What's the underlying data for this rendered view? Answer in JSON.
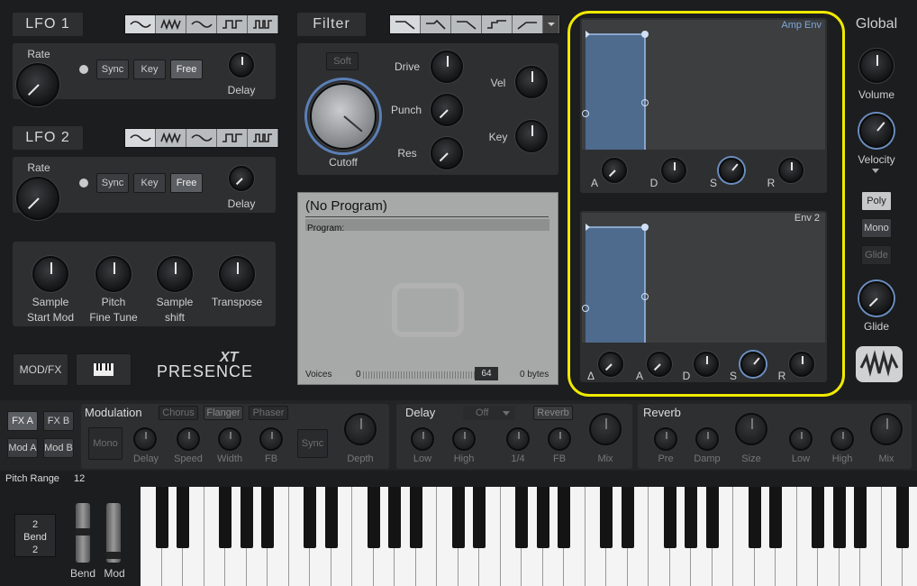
{
  "lfo1": {
    "title": "LFO 1",
    "rate": "Rate",
    "delay": "Delay",
    "sync": "Sync",
    "key": "Key",
    "free": "Free"
  },
  "lfo2": {
    "title": "LFO 2",
    "rate": "Rate",
    "delay": "Delay",
    "sync": "Sync",
    "key": "Key",
    "free": "Free"
  },
  "sample": {
    "start_mod": "Sample\nStart Mod",
    "start": "Sample",
    "start2": "Start Mod",
    "pitch": "Pitch",
    "fine": "Fine Tune",
    "shift1": "Sample",
    "shift2": "shift",
    "transpose": "Transpose"
  },
  "filter": {
    "title": "Filter",
    "soft": "Soft",
    "cutoff": "Cutoff",
    "drive": "Drive",
    "punch": "Punch",
    "res": "Res",
    "vel": "Vel",
    "key": "Key"
  },
  "program": {
    "name": "(No Program)",
    "label": "Program:",
    "voices": "Voices",
    "voices_min": "0",
    "voices_val": "64",
    "bytes": "0 bytes"
  },
  "amp_env": {
    "title": "Amp Env",
    "a": "A",
    "d": "D",
    "s": "S",
    "r": "R"
  },
  "env2": {
    "title": "Env 2",
    "delta": "Δ",
    "a": "A",
    "d": "D",
    "s": "S",
    "r": "R"
  },
  "global": {
    "title": "Global",
    "volume": "Volume",
    "velocity": "Velocity",
    "poly": "Poly",
    "mono": "Mono",
    "glide_btn": "Glide",
    "glide": "Glide"
  },
  "buttons": {
    "modfx": "MOD/FX",
    "brand": "PRESENCE",
    "brand_sup": "XT"
  },
  "fx": {
    "fxa": "FX A",
    "fxb": "FX B",
    "moda": "Mod A",
    "modb": "Mod B",
    "modulation": {
      "title": "Modulation",
      "chorus": "Chorus",
      "flanger": "Flanger",
      "phaser": "Phaser",
      "mono": "Mono",
      "delay": "Delay",
      "speed": "Speed",
      "width": "Width",
      "fb": "FB",
      "sync": "Sync",
      "depth": "Depth"
    },
    "delay": {
      "title": "Delay",
      "mode": "Off",
      "reverb": "Reverb",
      "low": "Low",
      "high": "High",
      "quarter": "1/4",
      "fb": "FB",
      "mix": "Mix"
    },
    "reverb": {
      "title": "Reverb",
      "pre": "Pre",
      "damp": "Damp",
      "size": "Size",
      "low": "Low",
      "high": "High",
      "mix": "Mix"
    }
  },
  "pitch_range": {
    "label": "Pitch Range",
    "value": "12"
  },
  "bend": {
    "top": "2",
    "label": "Bend",
    "bottom": "2",
    "bend": "Bend",
    "mod": "Mod"
  }
}
